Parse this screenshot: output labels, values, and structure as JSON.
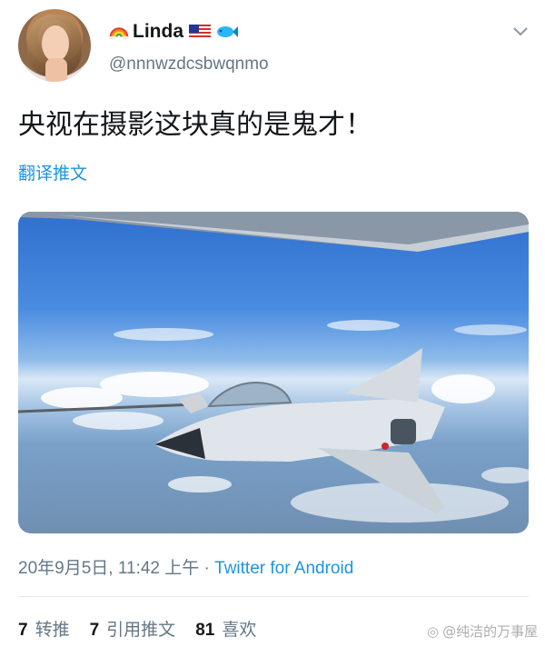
{
  "user": {
    "name": "Linda",
    "handle": "@nnnwzdcsbwqnmo",
    "name_emojis": [
      "rainbow-icon",
      "us-flag-icon",
      "fish-icon"
    ]
  },
  "tweet": {
    "text": "央视在摄影这块真的是鬼才！",
    "translate_label": "翻译推文"
  },
  "meta": {
    "timestamp": "20年9月5日, 11:42 上午",
    "separator": "·",
    "source": "Twitter for Android"
  },
  "stats": [
    {
      "count": "7",
      "label": "转推"
    },
    {
      "count": "7",
      "label": "引用推文"
    },
    {
      "count": "81",
      "label": "喜欢"
    }
  ],
  "watermark": "@纯洁的万事屋",
  "colors": {
    "link": "#1b95e0",
    "secondary": "#657786",
    "primary_text": "#14171a",
    "divider": "#e1e8ed"
  }
}
